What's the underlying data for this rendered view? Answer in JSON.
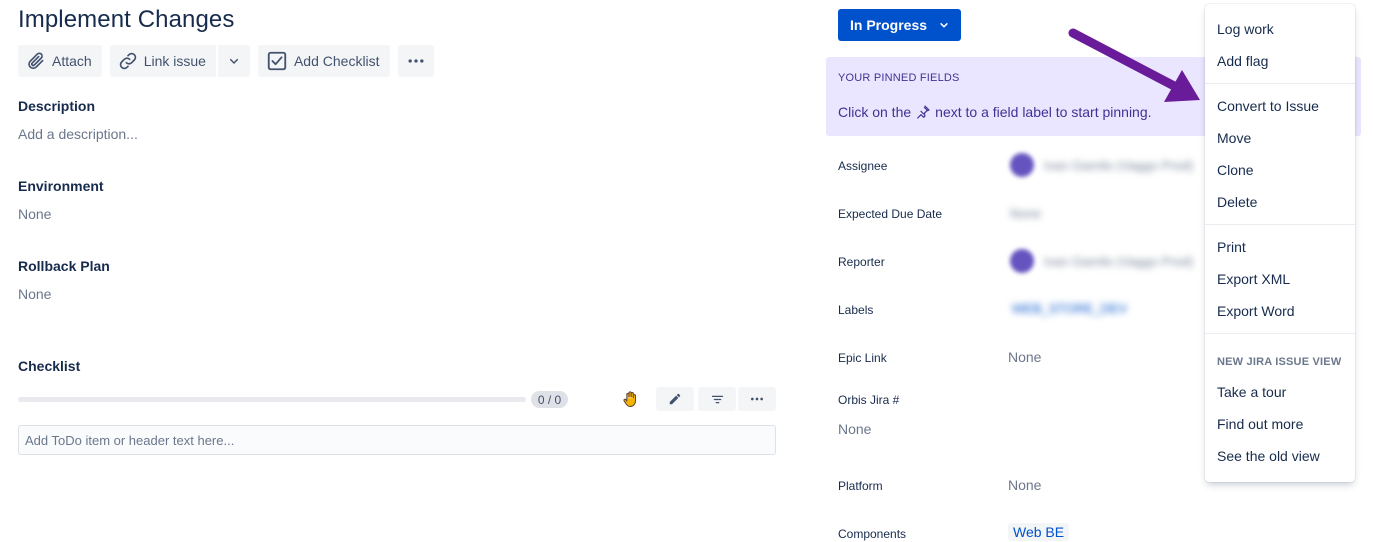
{
  "issue": {
    "title": "Implement Changes"
  },
  "toolbar": {
    "attach_label": "Attach",
    "link_issue_label": "Link issue",
    "add_checklist_label": "Add Checklist"
  },
  "fields": {
    "description": {
      "label": "Description",
      "placeholder": "Add a description..."
    },
    "environment": {
      "label": "Environment",
      "value": "None"
    },
    "rollback": {
      "label": "Rollback Plan",
      "value": "None"
    }
  },
  "checklist": {
    "label": "Checklist",
    "progress_text": "0 / 0",
    "progress_fraction": 0,
    "input_placeholder": "Add ToDo item or header text here..."
  },
  "status": {
    "label": "In Progress",
    "color": "#0052cc"
  },
  "pinned": {
    "title": "YOUR PINNED FIELDS",
    "text_before": "Click on the",
    "text_after": "next to a field label to start pinning.",
    "background": "#eae6ff"
  },
  "details": {
    "assignee": {
      "label": "Assignee",
      "value": "Ivan Gamilo (Vaggo Prod)"
    },
    "due_date": {
      "label": "Expected Due Date",
      "value": "None"
    },
    "reporter": {
      "label": "Reporter",
      "value": "Ivan Gamilo (Vaggo Prod)"
    },
    "labels": {
      "label": "Labels",
      "value": "WEB_STORE_DEV"
    },
    "epic_link": {
      "label": "Epic Link",
      "value": "None"
    },
    "orbis": {
      "label": "Orbis Jira #",
      "value": "None"
    },
    "platform": {
      "label": "Platform",
      "value": "None"
    },
    "components": {
      "label": "Components",
      "value": "Web BE"
    }
  },
  "menu": {
    "group1": [
      "Log work",
      "Add flag"
    ],
    "group2": [
      "Convert to Issue",
      "Move",
      "Clone",
      "Delete"
    ],
    "group3": [
      "Print",
      "Export XML",
      "Export Word"
    ],
    "new_view_header": "NEW JIRA ISSUE VIEW",
    "group4": [
      "Take a tour",
      "Find out more",
      "See the old view"
    ]
  },
  "annotation": {
    "arrow_color": "#6a1b9a"
  },
  "icons": [
    "paperclip-icon",
    "link-icon",
    "chevron-down-icon",
    "checkbox-icon",
    "more-icon",
    "hand-icon",
    "pencil-icon",
    "filter-icon",
    "pin-icon"
  ]
}
